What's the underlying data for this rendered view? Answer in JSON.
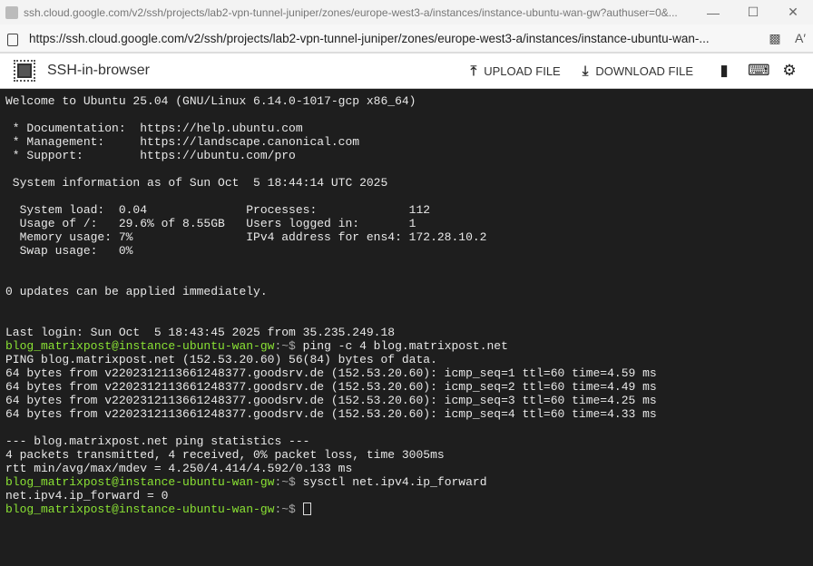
{
  "window": {
    "title": "ssh.cloud.google.com/v2/ssh/projects/lab2-vpn-tunnel-juniper/zones/europe-west3-a/instances/instance-ubuntu-wan-gw?authuser=0&...",
    "url": "https://ssh.cloud.google.com/v2/ssh/projects/lab2-vpn-tunnel-juniper/zones/europe-west3-a/instances/instance-ubuntu-wan-..."
  },
  "app": {
    "name": "SSH-in-browser",
    "upload": "UPLOAD FILE",
    "download": "DOWNLOAD FILE"
  },
  "terminal": {
    "prompt_user": "blog_matrixpost@instance-ubuntu-wan-gw",
    "prompt_sep": ":~$ ",
    "lines": [
      {
        "text": "Welcome to Ubuntu 25.04 (GNU/Linux 6.14.0-1017-gcp x86_64)"
      },
      {
        "text": ""
      },
      {
        "text": " * Documentation:  https://help.ubuntu.com"
      },
      {
        "text": " * Management:     https://landscape.canonical.com"
      },
      {
        "text": " * Support:        https://ubuntu.com/pro"
      },
      {
        "text": ""
      },
      {
        "text": " System information as of Sun Oct  5 18:44:14 UTC 2025"
      },
      {
        "text": ""
      },
      {
        "text": "  System load:  0.04              Processes:             112"
      },
      {
        "text": "  Usage of /:   29.6% of 8.55GB   Users logged in:       1"
      },
      {
        "text": "  Memory usage: 7%                IPv4 address for ens4: 172.28.10.2"
      },
      {
        "text": "  Swap usage:   0%"
      },
      {
        "text": ""
      },
      {
        "text": ""
      },
      {
        "text": "0 updates can be applied immediately."
      },
      {
        "text": ""
      },
      {
        "text": ""
      },
      {
        "text": "Last login: Sun Oct  5 18:43:45 2025 from 35.235.249.18"
      },
      {
        "cmd": "ping -c 4 blog.matrixpost.net"
      },
      {
        "text": "PING blog.matrixpost.net (152.53.20.60) 56(84) bytes of data."
      },
      {
        "text": "64 bytes from v2202312113661248377.goodsrv.de (152.53.20.60): icmp_seq=1 ttl=60 time=4.59 ms"
      },
      {
        "text": "64 bytes from v2202312113661248377.goodsrv.de (152.53.20.60): icmp_seq=2 ttl=60 time=4.49 ms"
      },
      {
        "text": "64 bytes from v2202312113661248377.goodsrv.de (152.53.20.60): icmp_seq=3 ttl=60 time=4.25 ms"
      },
      {
        "text": "64 bytes from v2202312113661248377.goodsrv.de (152.53.20.60): icmp_seq=4 ttl=60 time=4.33 ms"
      },
      {
        "text": ""
      },
      {
        "text": "--- blog.matrixpost.net ping statistics ---"
      },
      {
        "text": "4 packets transmitted, 4 received, 0% packet loss, time 3005ms"
      },
      {
        "text": "rtt min/avg/max/mdev = 4.250/4.414/4.592/0.133 ms"
      },
      {
        "cmd": "sysctl net.ipv4.ip_forward"
      },
      {
        "text": "net.ipv4.ip_forward = 0"
      },
      {
        "cmd": "",
        "cursor": true
      }
    ]
  }
}
